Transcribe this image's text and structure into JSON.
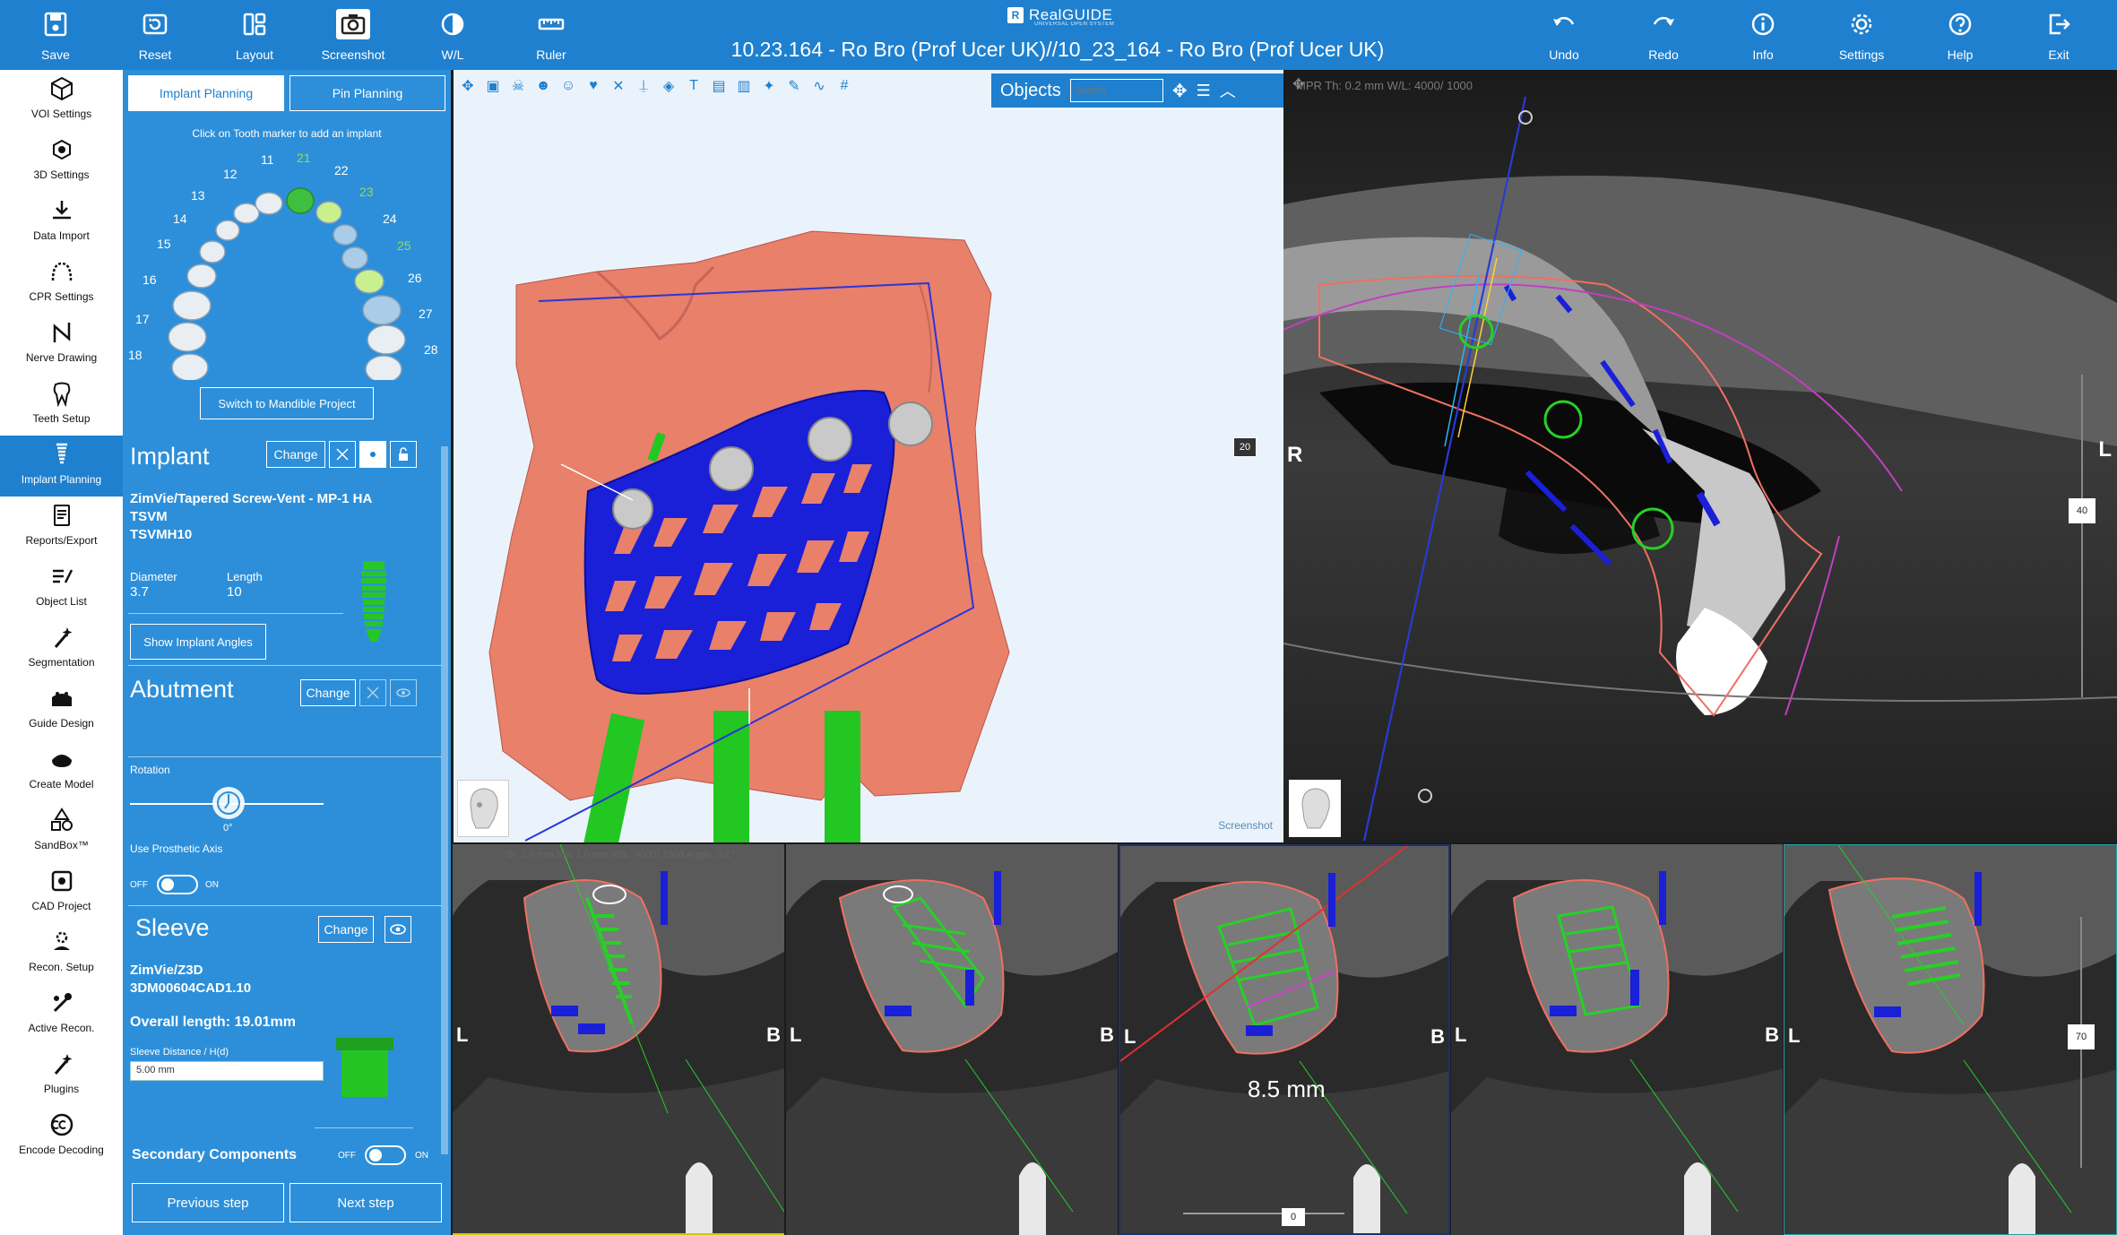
{
  "toolbar": {
    "save": "Save",
    "reset": "Reset",
    "layout": "Layout",
    "screenshot": "Screenshot",
    "wl": "W/L",
    "ruler": "Ruler",
    "undo": "Undo",
    "redo": "Redo",
    "info": "Info",
    "settings": "Settings",
    "help": "Help",
    "exit": "Exit"
  },
  "logo": {
    "mark": "R",
    "name": "RealGUIDE",
    "tagline": "UNIVERSAL OPEN SYSTEM"
  },
  "window_title": "10.23.164 - Ro Bro (Prof Ucer UK)//10_23_164 - Ro Bro (Prof Ucer UK)",
  "nav": [
    {
      "label": "VOI Settings",
      "icon": "cube-icon"
    },
    {
      "label": "3D Settings",
      "icon": "3d-cube-icon"
    },
    {
      "label": "Data Import",
      "icon": "download-icon"
    },
    {
      "label": "CPR Settings",
      "icon": "arc-icon"
    },
    {
      "label": "Nerve Drawing",
      "icon": "nerve-icon"
    },
    {
      "label": "Teeth Setup",
      "icon": "tooth-icon"
    },
    {
      "label": "Implant Planning",
      "icon": "implant-icon"
    },
    {
      "label": "Reports/Export",
      "icon": "report-icon"
    },
    {
      "label": "Object List",
      "icon": "list-icon"
    },
    {
      "label": "Segmentation",
      "icon": "wand-icon"
    },
    {
      "label": "Guide Design",
      "icon": "guide-icon"
    },
    {
      "label": "Create Model",
      "icon": "model-icon"
    },
    {
      "label": "SandBox™",
      "icon": "shapes-icon"
    },
    {
      "label": "CAD Project",
      "icon": "cad-icon"
    },
    {
      "label": "Recon. Setup",
      "icon": "recon-setup-icon"
    },
    {
      "label": "Active Recon.",
      "icon": "active-recon-icon"
    },
    {
      "label": "Plugins",
      "icon": "plugin-icon"
    },
    {
      "label": "Encode Decoding",
      "icon": "codec-icon"
    }
  ],
  "panel": {
    "tab_implant": "Implant Planning",
    "tab_pin": "Pin Planning",
    "tooth_hint": "Click on Tooth marker to add an implant",
    "teeth": [
      "11",
      "12",
      "13",
      "14",
      "15",
      "16",
      "17",
      "18",
      "21",
      "22",
      "23",
      "24",
      "25",
      "26",
      "27",
      "28"
    ],
    "switch_label": "Switch to Mandible Project",
    "implant": {
      "title": "Implant",
      "change": "Change",
      "name": "ZimVie/Tapered Screw-Vent - MP-1 HA",
      "line2": "TSVM",
      "line3": "TSVMH10",
      "diameter_label": "Diameter",
      "diameter": "3.7",
      "length_label": "Length",
      "length": "10",
      "show_angles": "Show Implant Angles"
    },
    "abutment": {
      "title": "Abutment",
      "change": "Change",
      "rotation_label": "Rotation",
      "rotation_value": "0°",
      "prosthetic_axis": "Use Prosthetic Axis",
      "off": "OFF",
      "on": "ON"
    },
    "sleeve": {
      "title": "Sleeve",
      "change": "Change",
      "name": "ZimVie/Z3D",
      "code": "3DM00604CAD1.10",
      "overall_length": "Overall length: 19.01mm",
      "distance_label": "Sleeve Distance / H(d)",
      "distance_value": "5.00 mm"
    },
    "secondary": {
      "title": "Secondary Components",
      "off": "OFF",
      "on": "ON"
    },
    "prev": "Previous step",
    "next": "Next step"
  },
  "view3d": {
    "objects_label": "Objects",
    "search_placeholder": "Search",
    "screenshot_label": "Screenshot",
    "zoom_badge": "20"
  },
  "mpr": {
    "info": "MPR    Th: 0.2 mm    W/L: 4000/ 1000",
    "left_letter": "R",
    "right_letter": "L",
    "slider_badge": "40"
  },
  "cross_sections": {
    "info": "Sl: 1.0 mm    Spl: 1.0 mm    W/L: 4000/ 1000    Angle: 0.1°",
    "left_letter": "L",
    "right_letter": "B",
    "measurement": "8.5 mm",
    "slider_badge": "70",
    "bottom_badge": "0"
  },
  "colors": {
    "accent": "#1f80cf",
    "panel": "#2d8fd9",
    "guide": "#1a1fd8",
    "bone": "#e8806a",
    "implant": "#1ec21e",
    "selected_tooth": "#8ee04a"
  }
}
